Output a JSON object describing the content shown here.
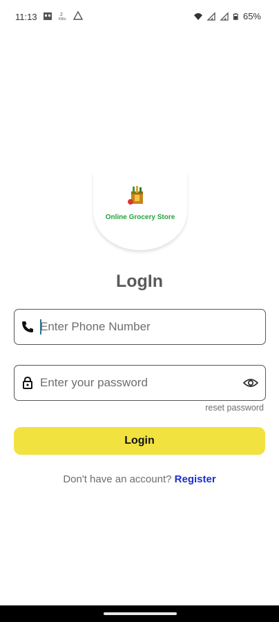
{
  "status_bar": {
    "time": "11:13",
    "icons_left": [
      "calendar-icon",
      "data-usage-icon",
      "warning-icon"
    ],
    "icons_right": [
      "wifi-icon",
      "signal-icon",
      "signal-icon-2",
      "battery-icon"
    ],
    "battery": "65%"
  },
  "logo": {
    "text": "Online Grocery Store",
    "icon": "grocery-bag-icon"
  },
  "page": {
    "title": "LogIn"
  },
  "form": {
    "phone_placeholder": "Enter Phone Number",
    "password_placeholder": "Enter your password",
    "reset_label": "reset password",
    "login_label": "Login"
  },
  "signup": {
    "prompt": "Don't have an account?",
    "link": "Register"
  },
  "colors": {
    "button": "#f1e23f",
    "logo_text": "#22a33c",
    "link": "#1b2fc9"
  }
}
